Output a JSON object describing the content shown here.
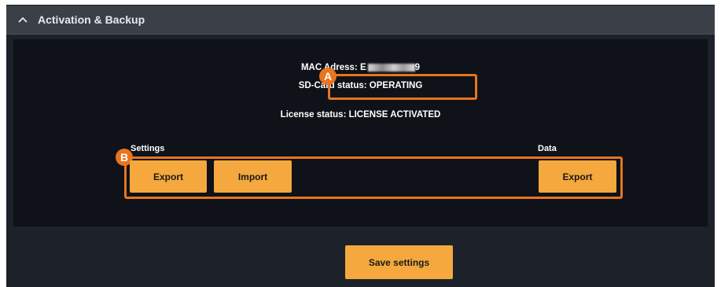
{
  "header": {
    "title": "Activation & Backup",
    "icon": "chevron-up-icon"
  },
  "status": {
    "mac_label": "MAC Adress: E",
    "mac_tail": "9",
    "sd_card": "SD-Card status: OPERATING",
    "license": "License status: LICENSE ACTIVATED"
  },
  "callouts": {
    "a": "A",
    "b": "B"
  },
  "settings": {
    "label": "Settings",
    "export_label": "Export",
    "import_label": "Import"
  },
  "data": {
    "label": "Data",
    "export_label": "Export"
  },
  "footer": {
    "save_label": "Save settings"
  },
  "colors": {
    "accent": "#f4a83d",
    "callout": "#e8741f",
    "panel": "#0f1218",
    "header": "#3b3f47"
  }
}
